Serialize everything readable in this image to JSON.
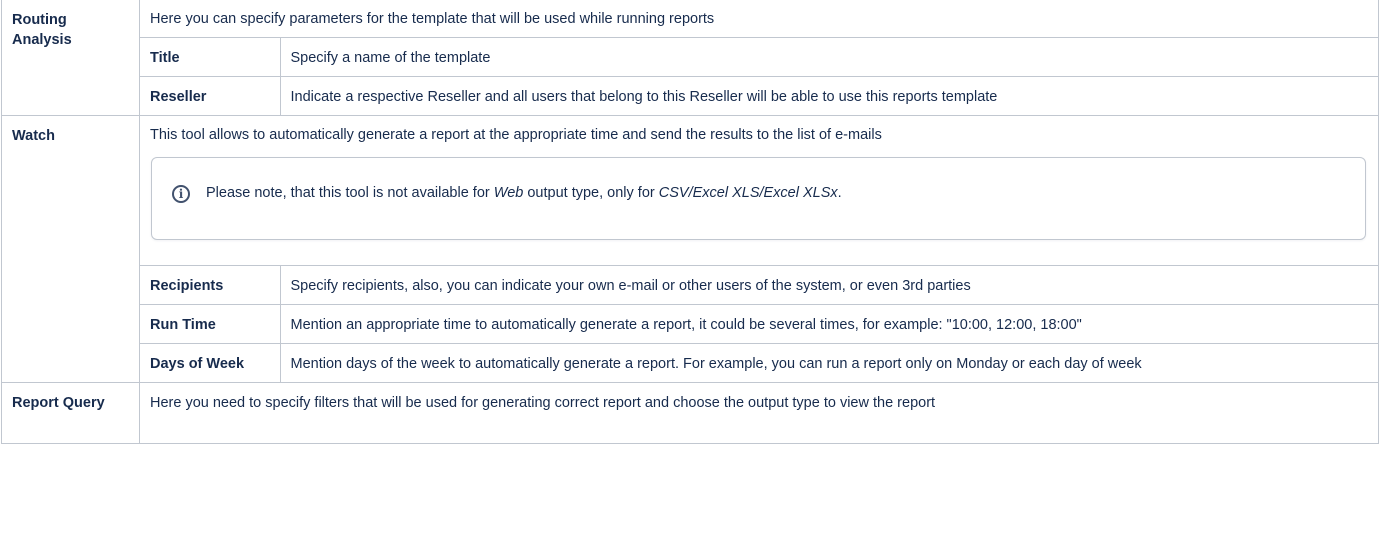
{
  "rows": {
    "routing": {
      "key": "Routing Analysis",
      "intro": "Here you can specify parameters for the template that will be used while running reports",
      "items": [
        {
          "key": "Title",
          "value": "Specify a name of the template"
        },
        {
          "key": "Reseller",
          "value": "Indicate a respective Reseller and all users that belong to this Reseller will be able to use this reports template"
        }
      ]
    },
    "watch": {
      "key": "Watch",
      "intro": "This tool allows to automatically generate a report at the appropriate time and send the results to the list of e-mails",
      "note": {
        "icon": "info-icon",
        "prefix": "Please note, that this tool is not available for ",
        "em1": "Web",
        "middle": " output type, only for ",
        "em2": "CSV/Excel XLS/Excel XLSx",
        "suffix": "."
      },
      "items": [
        {
          "key": "Recipients",
          "value": "Specify recipients, also, you can indicate your own e-mail or other users of the system, or even 3rd parties"
        },
        {
          "key": "Run Time",
          "value": "Mention an appropriate time to automatically generate a report, it could be several times, for example: \"10:00, 12:00, 18:00\""
        },
        {
          "key": "Days of Week",
          "value": "Mention days of the week to automatically generate a report. For example, you can run a report only on Monday or each day of week"
        }
      ]
    },
    "report_query": {
      "key": "Report Query",
      "intro": "Here you need to specify filters that will be used for generating correct report and choose the output type to view the report"
    }
  }
}
